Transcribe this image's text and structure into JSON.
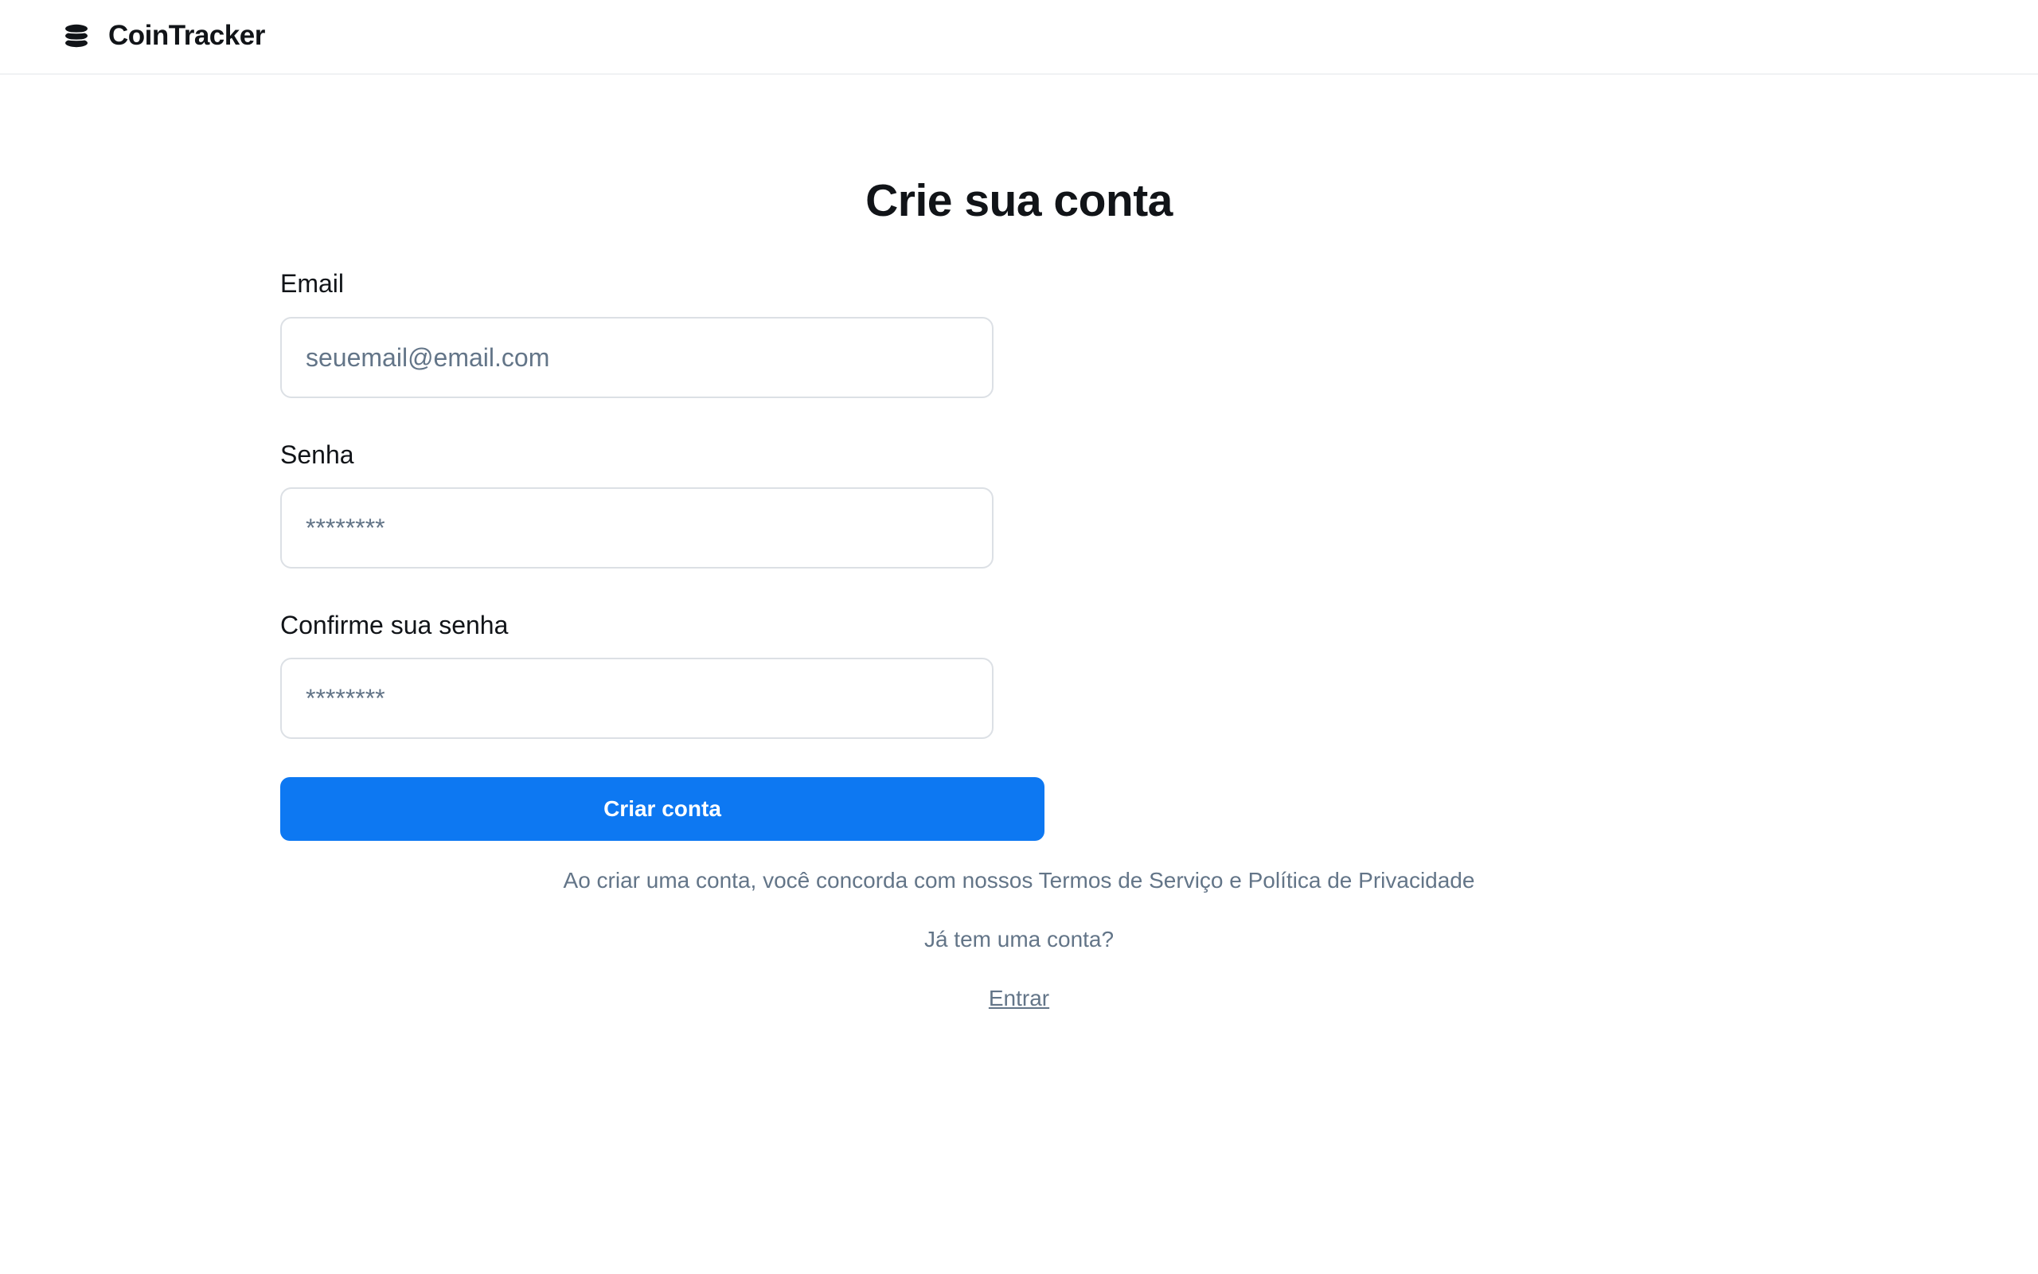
{
  "header": {
    "brand_icon": "stacked-coins-icon",
    "brand_name": "CoinTracker"
  },
  "form": {
    "title": "Crie sua conta",
    "email": {
      "label": "Email",
      "placeholder": "seuemail@email.com",
      "value": ""
    },
    "password": {
      "label": "Senha",
      "placeholder": "********",
      "value": ""
    },
    "confirm_password": {
      "label": "Confirme sua senha",
      "placeholder": "********",
      "value": ""
    },
    "submit_label": "Criar conta",
    "terms_text": "Ao criar uma conta, você concorda com nossos Termos de Serviço e Política de Privacidade",
    "have_account_text": "Já tem uma conta?",
    "login_link": "Entrar"
  },
  "colors": {
    "primary": "#0d78f2",
    "text": "#111418",
    "muted": "#637588",
    "border": "#dce0e5",
    "background": "#ffffff"
  }
}
